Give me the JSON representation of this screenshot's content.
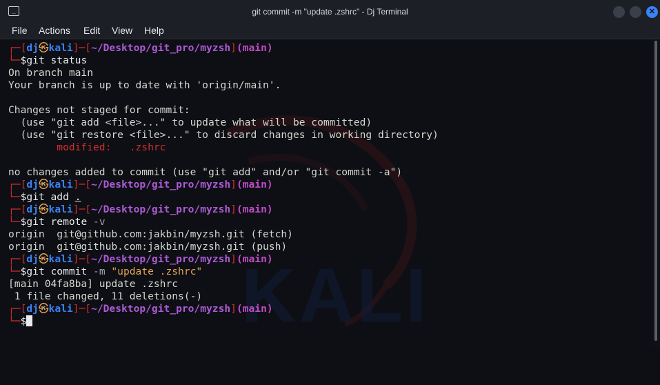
{
  "window": {
    "title": "git commit -m \"update .zshrc\" - Dj Terminal",
    "app_icon_glyph": "_",
    "close_glyph": "✕"
  },
  "menu": [
    "File",
    "Actions",
    "Edit",
    "View",
    "Help"
  ],
  "prompt": {
    "user": "dj",
    "skull": "㉿",
    "host": "kali",
    "path": "~/Desktop/git_pro/myzsh",
    "branch": "(main)",
    "open_bracket": "┌─[",
    "mid_bracket": "]─[",
    "close_bracket": "]",
    "second_line": "└─",
    "dollar": "$"
  },
  "terminal": {
    "cmd1": "git status",
    "out_branch": "On branch main",
    "out_uptodate": "Your branch is up to date with 'origin/main'.",
    "out_not_staged": "Changes not staged for commit:",
    "out_hint1": "  (use \"git add <file>...\" to update what will be committed)",
    "out_hint2": "  (use \"git restore <file>...\" to discard changes in working directory)",
    "out_modified": "        modified:   .zshrc",
    "out_no_changes": "no changes added to commit (use \"git add\" and/or \"git commit -a\")",
    "cmd2_git": "git",
    "cmd2_rest": " add ",
    "cmd2_dot": ".",
    "cmd3_git": "git",
    "cmd3_rest": " remote ",
    "cmd3_flag": "-v",
    "out_fetch": "origin  git@github.com:jakbin/myzsh.git (fetch)",
    "out_push": "origin  git@github.com:jakbin/myzsh.git (push)",
    "cmd4_git": "git",
    "cmd4_rest": " commit ",
    "cmd4_flag": "-m",
    "cmd4_str": " \"update .zshrc\"",
    "out_commit": "[main 04fa8ba] update .zshrc",
    "out_changed": " 1 file changed, 11 deletions(-)"
  },
  "watermark": "KALI"
}
